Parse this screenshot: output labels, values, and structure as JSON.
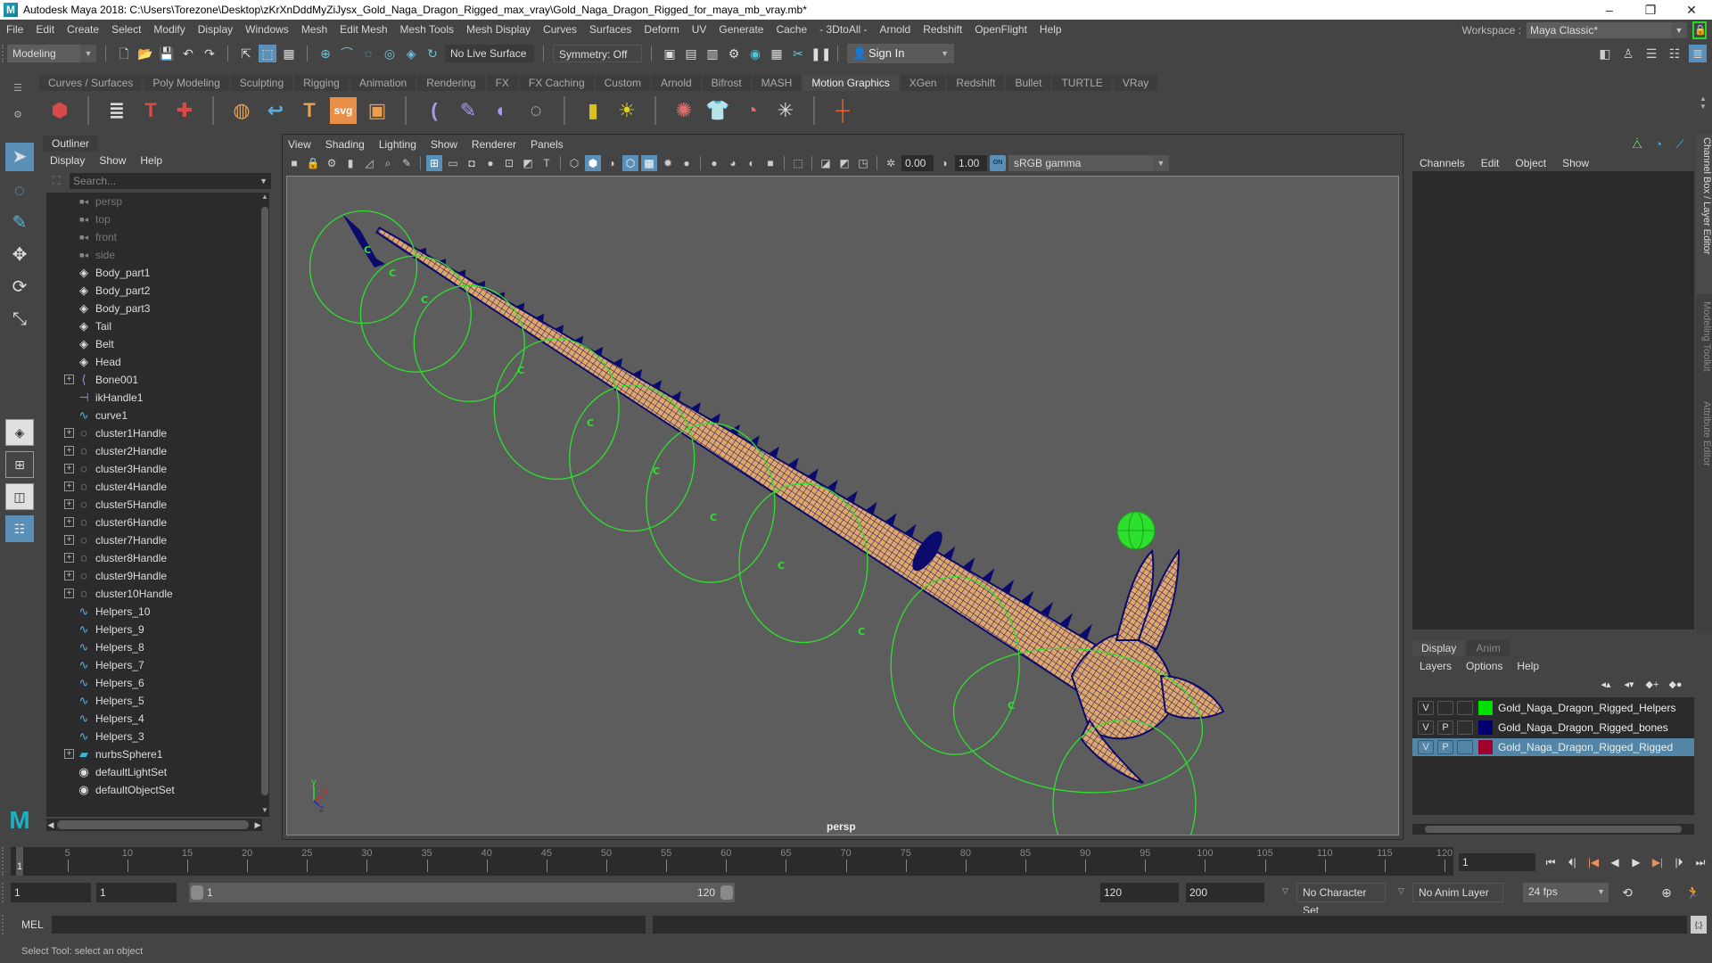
{
  "titlebar": {
    "title": "Autodesk Maya 2018: C:\\Users\\Torezone\\Desktop\\zKrXnDddMyZiJysx_Gold_Naga_Dragon_Rigged_max_vray\\Gold_Naga_Dragon_Rigged_for_maya_mb_vray.mb*",
    "logo": "M",
    "minimize": "–",
    "maximize": "❐",
    "close": "✕"
  },
  "menubar": {
    "items": [
      "File",
      "Edit",
      "Create",
      "Select",
      "Modify",
      "Display",
      "Windows",
      "Mesh",
      "Edit Mesh",
      "Mesh Tools",
      "Mesh Display",
      "Curves",
      "Surfaces",
      "Deform",
      "UV",
      "Generate",
      "Cache",
      "- 3DtoAll -",
      "Arnold",
      "Redshift",
      "OpenFlight",
      "Help"
    ],
    "workspace_label": "Workspace :",
    "workspace_value": "Maya Classic*"
  },
  "statusline": {
    "menuset": "Modeling",
    "live_surface": "No Live Surface",
    "symmetry": "Symmetry: Off",
    "sign_in": "Sign In"
  },
  "shelf": {
    "tabs": [
      "Curves / Surfaces",
      "Poly Modeling",
      "Sculpting",
      "Rigging",
      "Animation",
      "Rendering",
      "FX",
      "FX Caching",
      "Custom",
      "Arnold",
      "Bifrost",
      "MASH",
      "Motion Graphics",
      "XGen",
      "Redshift",
      "Bullet",
      "TURTLE",
      "VRay"
    ],
    "active_tab": "Motion Graphics"
  },
  "outliner": {
    "title": "Outliner",
    "menus": [
      "Display",
      "Show",
      "Help"
    ],
    "search_placeholder": "Search...",
    "items": [
      {
        "name": "persp",
        "type": "camera",
        "expandable": false
      },
      {
        "name": "top",
        "type": "camera",
        "expandable": false
      },
      {
        "name": "front",
        "type": "camera",
        "expandable": false
      },
      {
        "name": "side",
        "type": "camera",
        "expandable": false
      },
      {
        "name": "Body_part1",
        "type": "mesh",
        "expandable": false
      },
      {
        "name": "Body_part2",
        "type": "mesh",
        "expandable": false
      },
      {
        "name": "Body_part3",
        "type": "mesh",
        "expandable": false
      },
      {
        "name": "Tail",
        "type": "mesh",
        "expandable": false
      },
      {
        "name": "Belt",
        "type": "mesh",
        "expandable": false
      },
      {
        "name": "Head",
        "type": "mesh",
        "expandable": false
      },
      {
        "name": "Bone001",
        "type": "joint",
        "expandable": true
      },
      {
        "name": "ikHandle1",
        "type": "ikhandle",
        "expandable": false
      },
      {
        "name": "curve1",
        "type": "curve",
        "expandable": false
      },
      {
        "name": "cluster1Handle",
        "type": "cluster",
        "expandable": true
      },
      {
        "name": "cluster2Handle",
        "type": "cluster",
        "expandable": true
      },
      {
        "name": "cluster3Handle",
        "type": "cluster",
        "expandable": true
      },
      {
        "name": "cluster4Handle",
        "type": "cluster",
        "expandable": true
      },
      {
        "name": "cluster5Handle",
        "type": "cluster",
        "expandable": true
      },
      {
        "name": "cluster6Handle",
        "type": "cluster",
        "expandable": true
      },
      {
        "name": "cluster7Handle",
        "type": "cluster",
        "expandable": true
      },
      {
        "name": "cluster8Handle",
        "type": "cluster",
        "expandable": true
      },
      {
        "name": "cluster9Handle",
        "type": "cluster",
        "expandable": true
      },
      {
        "name": "cluster10Handle",
        "type": "cluster",
        "expandable": true
      },
      {
        "name": "Helpers_10",
        "type": "curve",
        "expandable": false
      },
      {
        "name": "Helpers_9",
        "type": "curve",
        "expandable": false
      },
      {
        "name": "Helpers_8",
        "type": "curve",
        "expandable": false
      },
      {
        "name": "Helpers_7",
        "type": "curve",
        "expandable": false
      },
      {
        "name": "Helpers_6",
        "type": "curve",
        "expandable": false
      },
      {
        "name": "Helpers_5",
        "type": "curve",
        "expandable": false
      },
      {
        "name": "Helpers_4",
        "type": "curve",
        "expandable": false
      },
      {
        "name": "Helpers_3",
        "type": "curve",
        "expandable": false
      },
      {
        "name": "nurbsSphere1",
        "type": "nurbs",
        "expandable": true
      },
      {
        "name": "defaultLightSet",
        "type": "set",
        "expandable": false
      },
      {
        "name": "defaultObjectSet",
        "type": "set",
        "expandable": false
      }
    ]
  },
  "viewport": {
    "menus": [
      "View",
      "Shading",
      "Lighting",
      "Show",
      "Renderer",
      "Panels"
    ],
    "exposure": "0.00",
    "gamma": "1.00",
    "color_mgmt_toggle": "ON",
    "view_transform": "sRGB gamma",
    "camera_label": "persp",
    "axis": {
      "x": "x",
      "y": "y",
      "z": "z"
    },
    "colors": {
      "background": "#5d5d5d",
      "wire": "#0b0b6e",
      "skin": "#e0a868",
      "helpers": "#2ee02e"
    }
  },
  "channelbox": {
    "menus": [
      "Channels",
      "Edit",
      "Object",
      "Show"
    ]
  },
  "side_tabs": [
    "Channel Box / Layer Editor",
    "Modeling Toolkit",
    "Attribute Editor"
  ],
  "layer_editor": {
    "tabs": [
      "Display",
      "Anim"
    ],
    "active_tab": "Display",
    "menus": [
      "Layers",
      "Options",
      "Help"
    ],
    "layers": [
      {
        "name": "Gold_Naga_Dragon_Rigged_Helpers",
        "visible": "V",
        "playback": "",
        "color": "#00e000",
        "selected": false
      },
      {
        "name": "Gold_Naga_Dragon_Rigged_bones",
        "visible": "V",
        "playback": "P",
        "color": "#000070",
        "selected": false
      },
      {
        "name": "Gold_Naga_Dragon_Rigged_Rigged",
        "visible": "V",
        "playback": "P",
        "color": "#a00030",
        "selected": true
      }
    ]
  },
  "timeline": {
    "start": 1,
    "end": 120,
    "tick_labels": [
      5,
      10,
      15,
      20,
      25,
      30,
      35,
      40,
      45,
      50,
      55,
      60,
      65,
      70,
      75,
      80,
      85,
      90,
      95,
      100,
      105,
      110,
      115,
      120
    ],
    "current_frame": "1",
    "current_frame_marker": "1"
  },
  "range": {
    "anim_start": "1",
    "playback_start": "1",
    "range_start_label": "1",
    "range_end_label": "120",
    "playback_end": "120",
    "anim_end": "200",
    "character_set": "No Character Set",
    "anim_layer": "No Anim Layer",
    "fps": "24 fps"
  },
  "commandline": {
    "language": "MEL",
    "input_value": ""
  },
  "helpline": {
    "text": "Select Tool: select an object"
  }
}
